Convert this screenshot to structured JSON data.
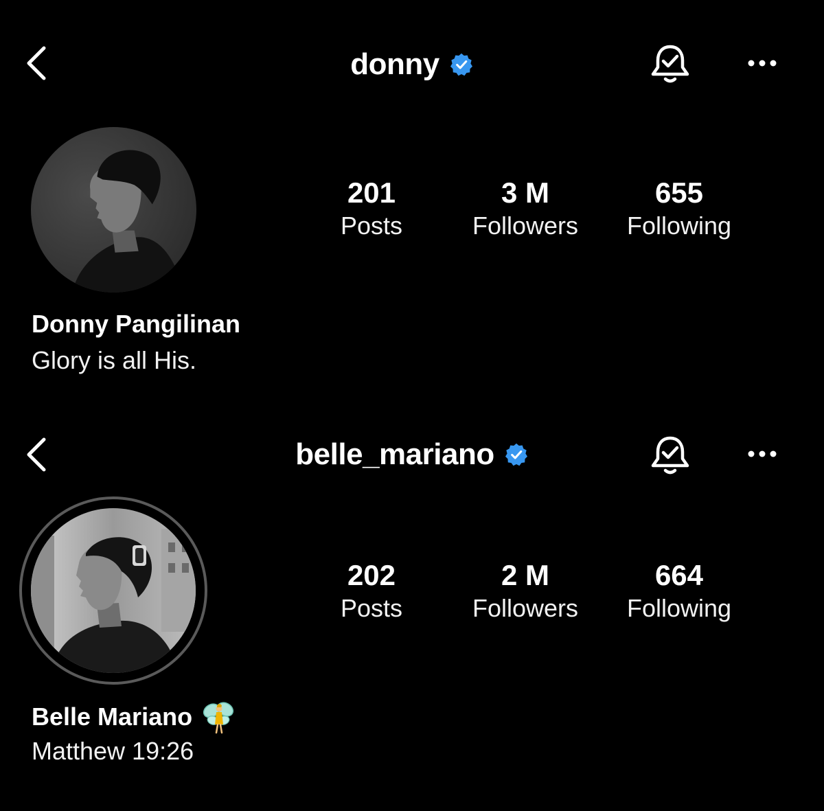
{
  "colors": {
    "background": "#000000",
    "text": "#ffffff",
    "verified_badge": "#3897f0"
  },
  "profiles": [
    {
      "username": "donny",
      "verified": true,
      "stats": [
        {
          "value": "201",
          "label": "Posts"
        },
        {
          "value": "3 M",
          "label": "Followers"
        },
        {
          "value": "655",
          "label": "Following"
        }
      ],
      "full_name": "Donny Pangilinan",
      "bio": "Glory is all His.",
      "has_story_ring": false
    },
    {
      "username": "belle_mariano",
      "verified": true,
      "stats": [
        {
          "value": "202",
          "label": "Posts"
        },
        {
          "value": "2 M",
          "label": "Followers"
        },
        {
          "value": "664",
          "label": "Following"
        }
      ],
      "full_name": "Belle Mariano",
      "name_emoji": "fairy",
      "bio": "Matthew 19:26",
      "has_story_ring": true
    }
  ],
  "icons": {
    "back": "chevron-left-icon",
    "verified": "verified-badge-icon",
    "notifications": "bell-check-icon",
    "more": "more-horizontal-icon"
  }
}
